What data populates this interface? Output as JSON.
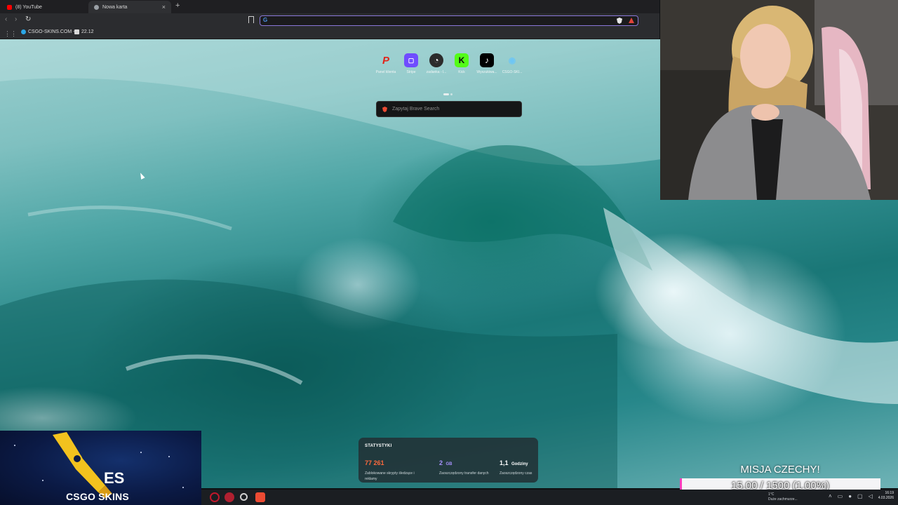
{
  "browser": {
    "tabs": [
      {
        "label": "(8) YouTube",
        "favicon": "youtube-icon",
        "color": "#ff0000"
      },
      {
        "label": "Nowa karta",
        "favicon": "brave-icon",
        "color": "#9aa0a6",
        "active": true
      }
    ],
    "new_tab_symbol": "+",
    "bookmarks": [
      {
        "label": "CSGO-SKINS.COM -...",
        "favicon": "csgo-skins-icon",
        "color": "#2aa7e6"
      },
      {
        "label": "22.12",
        "favicon": "page-icon",
        "color": "#d9d9d9"
      }
    ],
    "omnibox": {
      "value": "",
      "provider_glyph": "G"
    }
  },
  "newtab": {
    "shortcuts": [
      {
        "label": "Panel klienta",
        "glyph": "P",
        "color": "#e2231a",
        "bg": "transparent",
        "icon": "paypal-icon"
      },
      {
        "label": "Stripe",
        "glyph": "▢",
        "color": "#ffffff",
        "bg": "#6f4cff",
        "icon": "stripe-icon"
      },
      {
        "label": "zadanka - l...",
        "glyph": "◔",
        "color": "#ffffff",
        "bg": "#2c2c2c",
        "icon": "openai-icon"
      },
      {
        "label": "Kick",
        "glyph": "K",
        "color": "#0b0b0b",
        "bg": "#53fc18",
        "icon": "kick-icon"
      },
      {
        "label": "Wyszukiwa...",
        "glyph": "♪",
        "color": "#ffffff",
        "bg": "#000000",
        "icon": "tiktok-icon"
      },
      {
        "label": "CSGO-SKI...",
        "glyph": "◉",
        "color": "#6ec6f5",
        "bg": "transparent",
        "icon": "csgo-skins-icon"
      }
    ],
    "search_placeholder": "Zapytaj Brave Search",
    "stats": {
      "title": "STATYSTYKI",
      "items": [
        {
          "value": "77 261",
          "unit": "",
          "desc": "Zablokowane skrypty śledzące i reklamy",
          "color": "#ff6a3d"
        },
        {
          "value": "2",
          "unit": "GB",
          "desc": "Zaoszczędzony transfer danych",
          "color": "#a992ff"
        },
        {
          "value": "1,1",
          "unit": "Godziny",
          "desc": "Zaoszczędzony czas",
          "color": "#ffffff"
        }
      ]
    }
  },
  "overlay": {
    "logo_text": "CSGO SKINS",
    "mission_title": "MISJA CZECHY!",
    "mission_value": "15.00 / 1500 (1.00%)",
    "mission_progress": 0.01,
    "mission_fill_color": "#ff3dbd"
  },
  "taskbar": {
    "weather_temp": "1°C",
    "weather_text": "Duże zachmurze...",
    "time": "16:19",
    "date": "4.03.2026"
  }
}
